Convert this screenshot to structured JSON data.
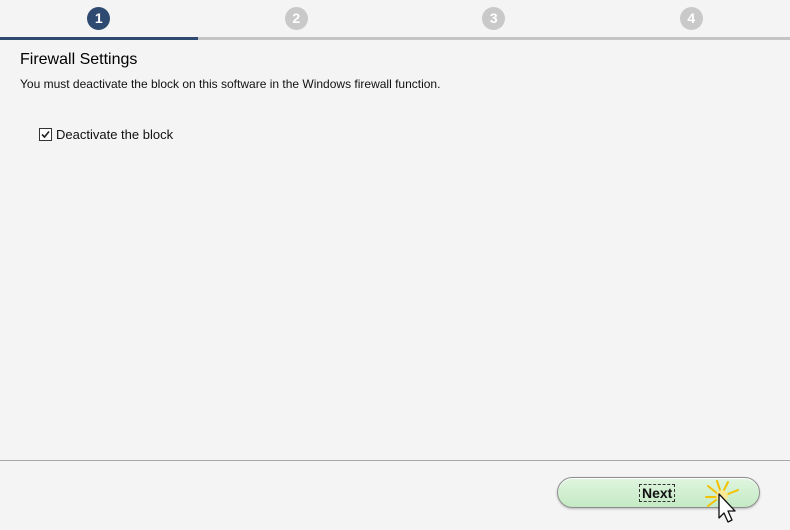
{
  "steps": [
    {
      "number": "1",
      "active": true
    },
    {
      "number": "2",
      "active": false
    },
    {
      "number": "3",
      "active": false
    },
    {
      "number": "4",
      "active": false
    }
  ],
  "content": {
    "title": "Firewall Settings",
    "description": "You must deactivate the block on this software in the Windows firewall function.",
    "checkbox_label": "Deactivate the block",
    "checkbox_checked": true
  },
  "footer": {
    "next_label": "Next"
  },
  "colors": {
    "active_step": "#2f4a70",
    "inactive_step": "#c9c9c9",
    "button_green": "#c4eac4"
  }
}
